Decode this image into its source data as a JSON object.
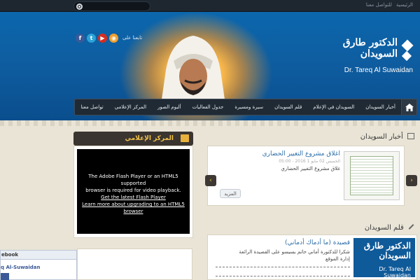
{
  "topbar": {
    "links": [
      "الرئيسية",
      "للتواصل معنا"
    ]
  },
  "search": {
    "placeholder": ""
  },
  "social": {
    "label": "تابعنا على",
    "icons": [
      "facebook-icon",
      "twitter-icon",
      "youtube-icon",
      "rss-icon"
    ],
    "glyphs": [
      "f",
      "t",
      "▶",
      "◉"
    ]
  },
  "logo": {
    "arabic": "الدكتور طارق السويدان",
    "english": "Dr. Tareq Al Suwaidan"
  },
  "nav": {
    "items": [
      "أخبار السويدان",
      "السويدان في الإعلام",
      "قلم السويدان",
      "سيرة ومسيرة",
      "جدول الفعاليات",
      "ألبوم الصور",
      "المركز الإعلامي",
      "تواصل معنا"
    ]
  },
  "news_section": {
    "title": "أخبار السويدان",
    "item_title": "اغلاق مشروع التغيير الحضاري",
    "item_date": "الخميس 02 مايو 1 2016 - 05:00",
    "item_excerpt": "غلاق مشروع التغيير الحضاري",
    "more": "المزيد",
    "prev": "‹",
    "next": "›"
  },
  "media_center": {
    "title": "المركز الإعلامي",
    "flash_line1": "The Adobe Flash Player or an HTML5 supported",
    "flash_line2": "browser is required for video playback.",
    "flash_link1": "Get the latest Flash Player",
    "flash_link2": "Learn more about upgrading to an HTML5",
    "flash_link3": "browser"
  },
  "pen_section": {
    "title": "قلم السويدان",
    "item_title": "قصيدة (ما أدماك أدماني)",
    "text1": "شكرا للدكتورة أماني حاتم بسيسو على القصيدة الرائعة",
    "text2": "إدارة الموقع"
  },
  "facebook": {
    "header": "ebook",
    "name": "q Al-Suwaidan"
  },
  "colors": {
    "header_blue": "#0e5da0",
    "nav_dark": "#202a34",
    "accent_gold": "#f2c14a",
    "link_blue": "#2d6ea8"
  }
}
